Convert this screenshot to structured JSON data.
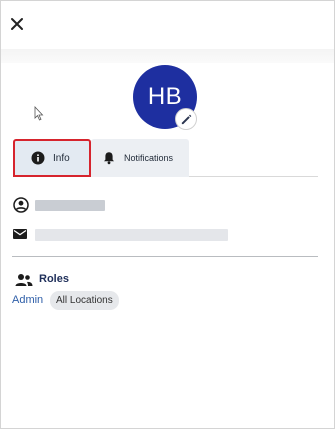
{
  "header": {
    "close_icon": "close-icon"
  },
  "profile": {
    "initials": "HB",
    "avatar_color": "#1e2fa0",
    "edit_icon": "pencil-icon"
  },
  "tabs": [
    {
      "label": "Info",
      "icon": "info-icon",
      "selected": true
    },
    {
      "label": "Notifications",
      "icon": "bell-icon",
      "selected": false
    }
  ],
  "info_rows": [
    {
      "icon": "account-circle-icon",
      "value": ""
    },
    {
      "icon": "mail-icon",
      "value": ""
    }
  ],
  "roles": {
    "heading": "Roles",
    "icon": "people-icon",
    "items": [
      {
        "role": "Admin",
        "scope": "All Locations"
      }
    ]
  },
  "colors": {
    "accent": "#1e2fa0",
    "highlight_border": "#d6242d",
    "link": "#2e5ea8"
  }
}
